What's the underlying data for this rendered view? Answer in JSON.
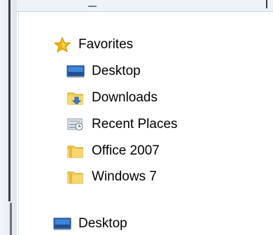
{
  "navigation": {
    "favorites": {
      "header_label": "Favorites",
      "header_icon": "star-icon",
      "items": [
        {
          "label": "Desktop",
          "icon": "monitor-icon"
        },
        {
          "label": "Downloads",
          "icon": "downloads-folder-icon"
        },
        {
          "label": "Recent Places",
          "icon": "recent-places-icon"
        },
        {
          "label": "Office 2007",
          "icon": "folder-icon"
        },
        {
          "label": "Windows 7",
          "icon": "folder-icon"
        }
      ]
    },
    "root": {
      "label": "Desktop",
      "icon": "monitor-icon"
    }
  },
  "colors": {
    "star": "#f5b400",
    "folder": "#f4cc55",
    "monitor": "#2c66b8",
    "download_arrow": "#2f7cd8"
  }
}
